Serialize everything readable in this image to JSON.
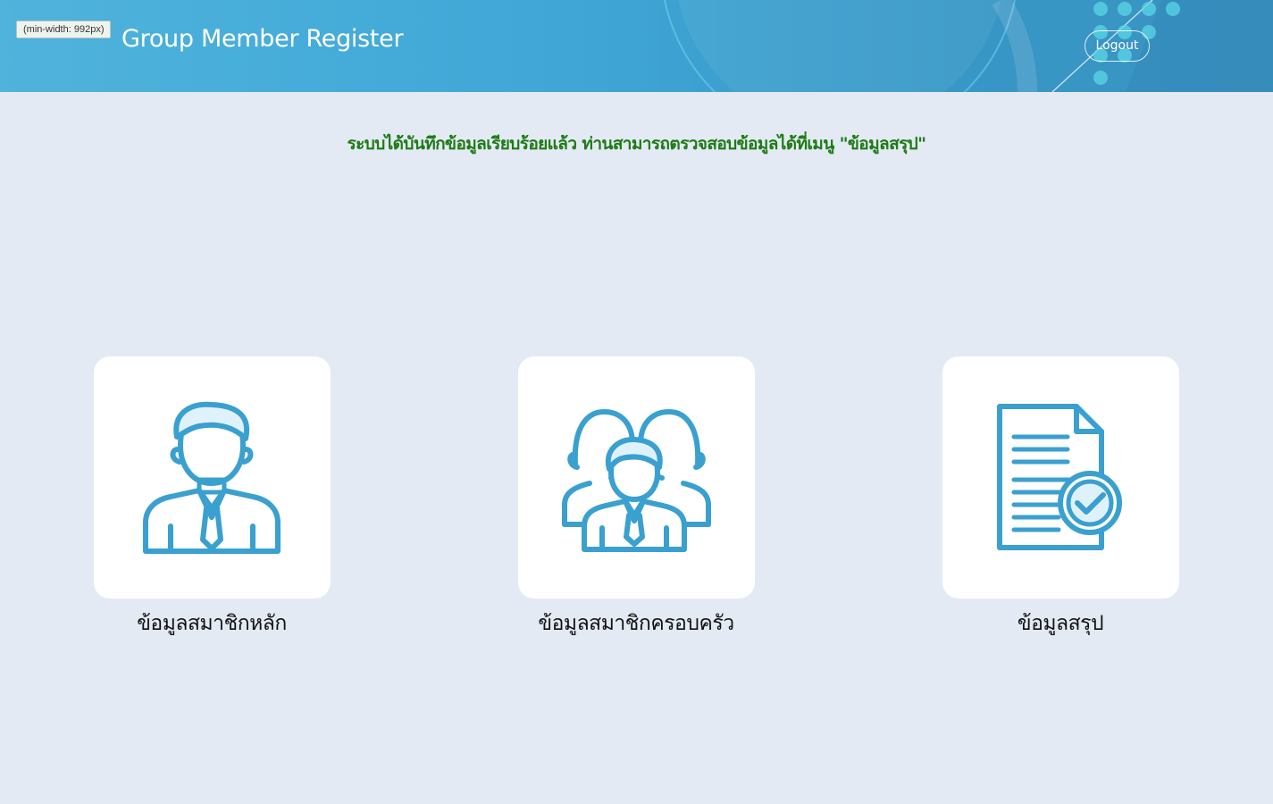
{
  "debug_badge": "(min-width: 992px)",
  "header": {
    "title": "Group Member Register",
    "logout_label": "Logout"
  },
  "message": "ระบบได้บันทึกข้อมูลเรียบร้อยแล้ว ท่านสามารถตรวจสอบข้อมูลได้ที่เมนู \"ข้อมูลสรุป\"",
  "menu": {
    "items": [
      {
        "label": "ข้อมูลสมาชิกหลัก",
        "icon": "person-icon"
      },
      {
        "label": "ข้อมูลสมาชิกครอบครัว",
        "icon": "group-icon"
      },
      {
        "label": "ข้อมูลสรุป",
        "icon": "document-check-icon"
      }
    ]
  },
  "colors": {
    "header": "#3fa6d6",
    "background": "#e3eaf4",
    "icon": "#3aa0d0",
    "message": "#1f7a16"
  }
}
